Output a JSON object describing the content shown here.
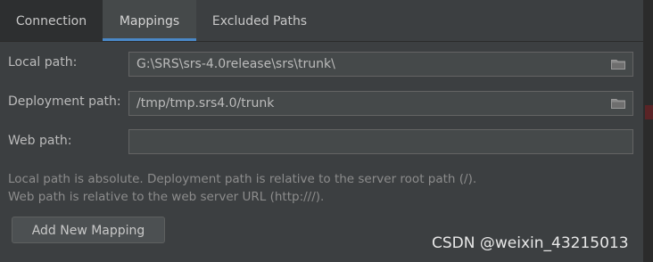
{
  "tabs": [
    {
      "label": "Connection"
    },
    {
      "label": "Mappings"
    },
    {
      "label": "Excluded Paths"
    }
  ],
  "selected_tab": "Mappings",
  "form": {
    "local_path": {
      "label": "Local path:",
      "value": "G:\\SRS\\srs-4.0release\\srs\\trunk\\"
    },
    "deployment_path": {
      "label": "Deployment path:",
      "value": "/tmp/tmp.srs4.0/trunk"
    },
    "web_path": {
      "label": "Web path:",
      "value": ""
    }
  },
  "hints": {
    "line1": "Local path is absolute. Deployment path is relative to the server root path (/).",
    "line2": "Web path is relative to the web server URL (http:///)."
  },
  "buttons": {
    "add_mapping": "Add New Mapping"
  },
  "watermark": "CSDN @weixin_43215013",
  "colors": {
    "background": "#3c3f41",
    "selected_tab_underline": "#4a88c7",
    "field_bg": "#45494a"
  },
  "icons": {
    "browse": "folder-icon"
  }
}
